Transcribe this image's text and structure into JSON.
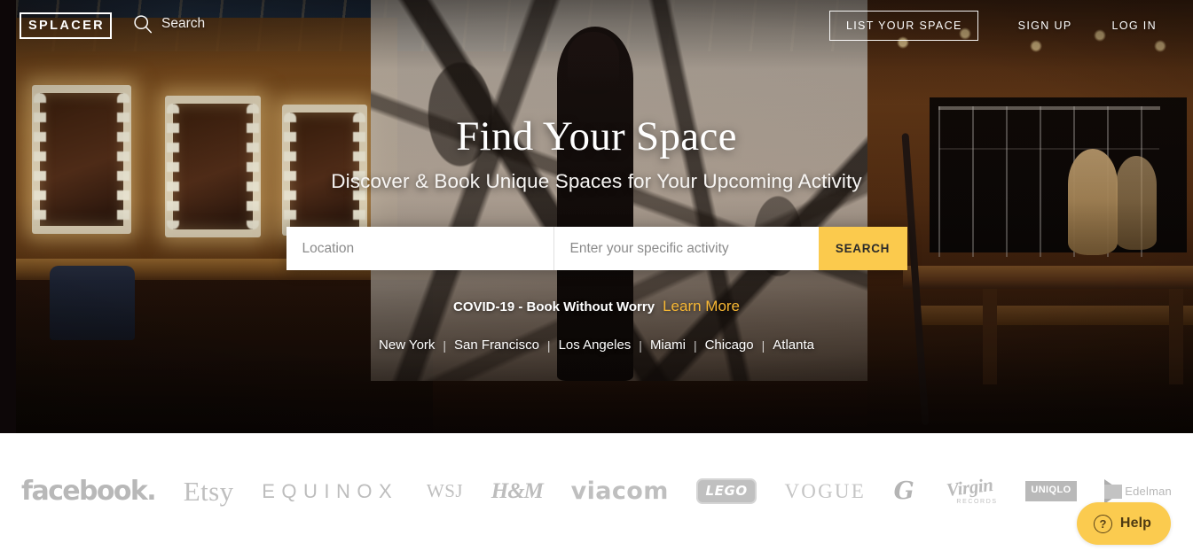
{
  "header": {
    "logo_text": "SPLACER",
    "search_nav_label": "Search",
    "search_icon": "search-icon",
    "list_your_space": "LIST YOUR SPACE",
    "sign_up": "SIGN UP",
    "log_in": "LOG IN"
  },
  "hero": {
    "title": "Find Your Space",
    "subtitle": "Discover & Book Unique Spaces for Your Upcoming Activity",
    "search": {
      "location_placeholder": "Location",
      "location_value": "",
      "activity_placeholder": "Enter your specific activity",
      "activity_value": "",
      "button_label": "SEARCH",
      "button_color": "#FBCA4D"
    },
    "covid": {
      "text": "COVID-19 - Book Without Worry",
      "link_label": "Learn More",
      "link_color": "#F7B733"
    },
    "cities": [
      {
        "label": "New York"
      },
      {
        "label": "San Francisco"
      },
      {
        "label": "Los Angeles"
      },
      {
        "label": "Miami"
      },
      {
        "label": "Chicago"
      },
      {
        "label": "Atlanta"
      }
    ],
    "city_separator": "|"
  },
  "brands": [
    {
      "name": "facebook",
      "label": "facebook."
    },
    {
      "name": "etsy",
      "label": "Etsy"
    },
    {
      "name": "equinox",
      "label": "EQUINOX"
    },
    {
      "name": "wsj",
      "label": "WSJ"
    },
    {
      "name": "hm",
      "label": "H&M"
    },
    {
      "name": "viacom",
      "label": "viacom"
    },
    {
      "name": "lego",
      "label": "LEGO"
    },
    {
      "name": "vogue",
      "label": "VOGUE"
    },
    {
      "name": "gatorade",
      "label": "G"
    },
    {
      "name": "virgin",
      "label": "Virgin",
      "sub": "RECORDS"
    },
    {
      "name": "uniqlo",
      "label": "UNI",
      "sub": "QLO"
    },
    {
      "name": "edelman",
      "label": "Edelman"
    }
  ],
  "help_widget": {
    "label": "Help",
    "icon": "question-circle-icon",
    "glyph": "?",
    "color": "#FBCB4F"
  }
}
